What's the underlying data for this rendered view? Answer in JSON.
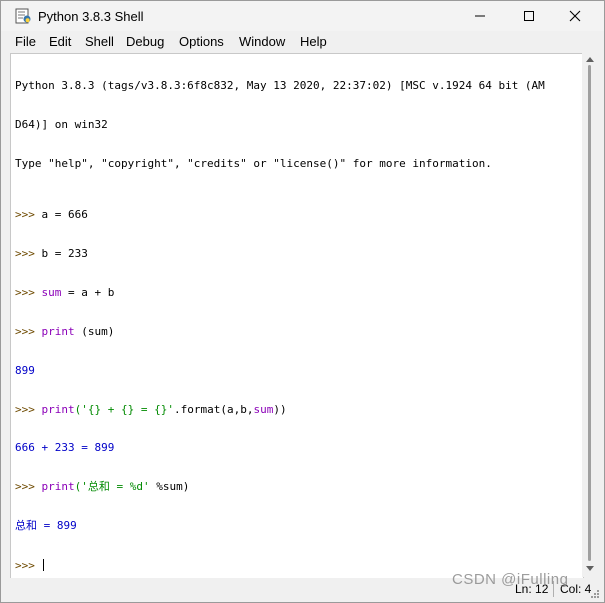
{
  "window": {
    "title": "Python 3.8.3 Shell"
  },
  "menu": {
    "file": "File",
    "edit": "Edit",
    "shell": "Shell",
    "debug": "Debug",
    "options": "Options",
    "window": "Window",
    "help": "Help"
  },
  "shell": {
    "banner_line1": "Python 3.8.3 (tags/v3.8.3:6f8c832, May 13 2020, 22:37:02) [MSC v.1924 64 bit (AM",
    "banner_line2": "D64)] on win32",
    "banner_line3": "Type \"help\", \"copyright\", \"credits\" or \"license()\" for more information.",
    "prompt": ">>> ",
    "lines": [
      {
        "kind": "input",
        "code": "a = 666"
      },
      {
        "kind": "input",
        "code": "b = 233"
      },
      {
        "kind": "input",
        "code_kw": "sum",
        "code_rest": " = a + b"
      },
      {
        "kind": "input",
        "code_kw": "print",
        "code_rest": " (sum)"
      },
      {
        "kind": "output",
        "text": "899"
      },
      {
        "kind": "input",
        "code_kw": "print",
        "code_str": "('{} + {} = {}'",
        "code_rest": ".format(a,b,",
        "code_kw2": "sum",
        "code_tail": "))"
      },
      {
        "kind": "output",
        "text": "666 + 233 = 899"
      },
      {
        "kind": "input",
        "code_kw": "print",
        "code_str": "('总和 = %d'",
        "code_rest": " %sum)"
      },
      {
        "kind": "output",
        "text": "总和 = 899"
      }
    ]
  },
  "status": {
    "ln": "Ln: 12",
    "col": "Col: 4"
  },
  "watermark": "CSDN @iFulling",
  "colors": {
    "prompt": "#6e4a00",
    "keyword": "#8b00b8",
    "string": "#008a00",
    "output": "#0000c8"
  }
}
